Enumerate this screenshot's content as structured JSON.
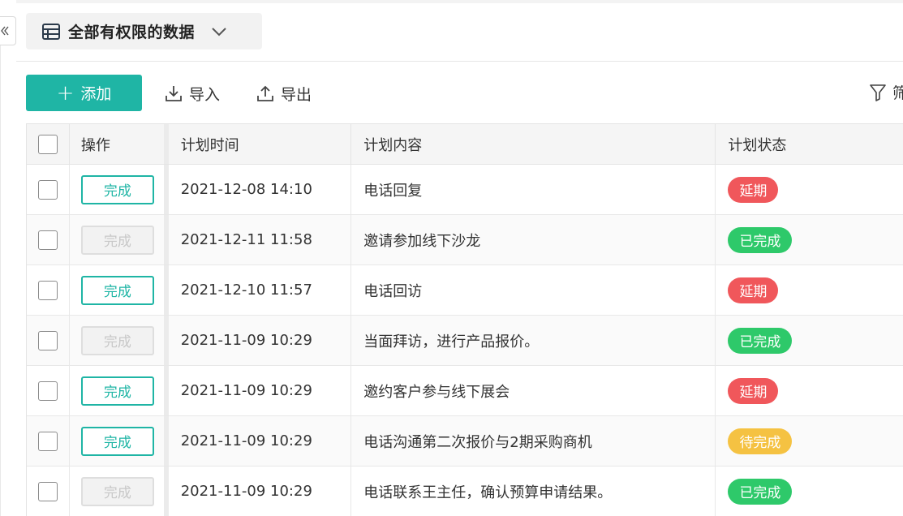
{
  "view_selector": {
    "title": "全部有权限的数据"
  },
  "toolbar": {
    "add_label": "添加",
    "import_label": "导入",
    "export_label": "导出",
    "filter_label": "筛"
  },
  "table": {
    "columns": [
      "操作",
      "计划时间",
      "计划内容",
      "计划状态"
    ],
    "rows": [
      {
        "action": "完成",
        "action_enabled": true,
        "time": "2021-12-08 14:10",
        "content": "电话回复",
        "status": "延期"
      },
      {
        "action": "完成",
        "action_enabled": false,
        "time": "2021-12-11 11:58",
        "content": "邀请参加线下沙龙",
        "status": "已完成"
      },
      {
        "action": "完成",
        "action_enabled": true,
        "time": "2021-12-10 11:57",
        "content": "电话回访",
        "status": "延期"
      },
      {
        "action": "完成",
        "action_enabled": false,
        "time": "2021-11-09 10:29",
        "content": "当面拜访，进行产品报价。",
        "status": "已完成"
      },
      {
        "action": "完成",
        "action_enabled": true,
        "time": "2021-11-09 10:29",
        "content": "邀约客户参与线下展会",
        "status": "延期"
      },
      {
        "action": "完成",
        "action_enabled": true,
        "time": "2021-11-09 10:29",
        "content": "电话沟通第二次报价与2期采购商机",
        "status": "待完成"
      },
      {
        "action": "完成",
        "action_enabled": false,
        "time": "2021-11-09 10:29",
        "content": "电话联系王主任，确认预算申请结果。",
        "status": "已完成"
      }
    ]
  },
  "status_colors": {
    "延期": "#f0575b",
    "已完成": "#2ec96a",
    "待完成": "#f5c242"
  },
  "colors": {
    "accent": "#1fb5a5"
  }
}
